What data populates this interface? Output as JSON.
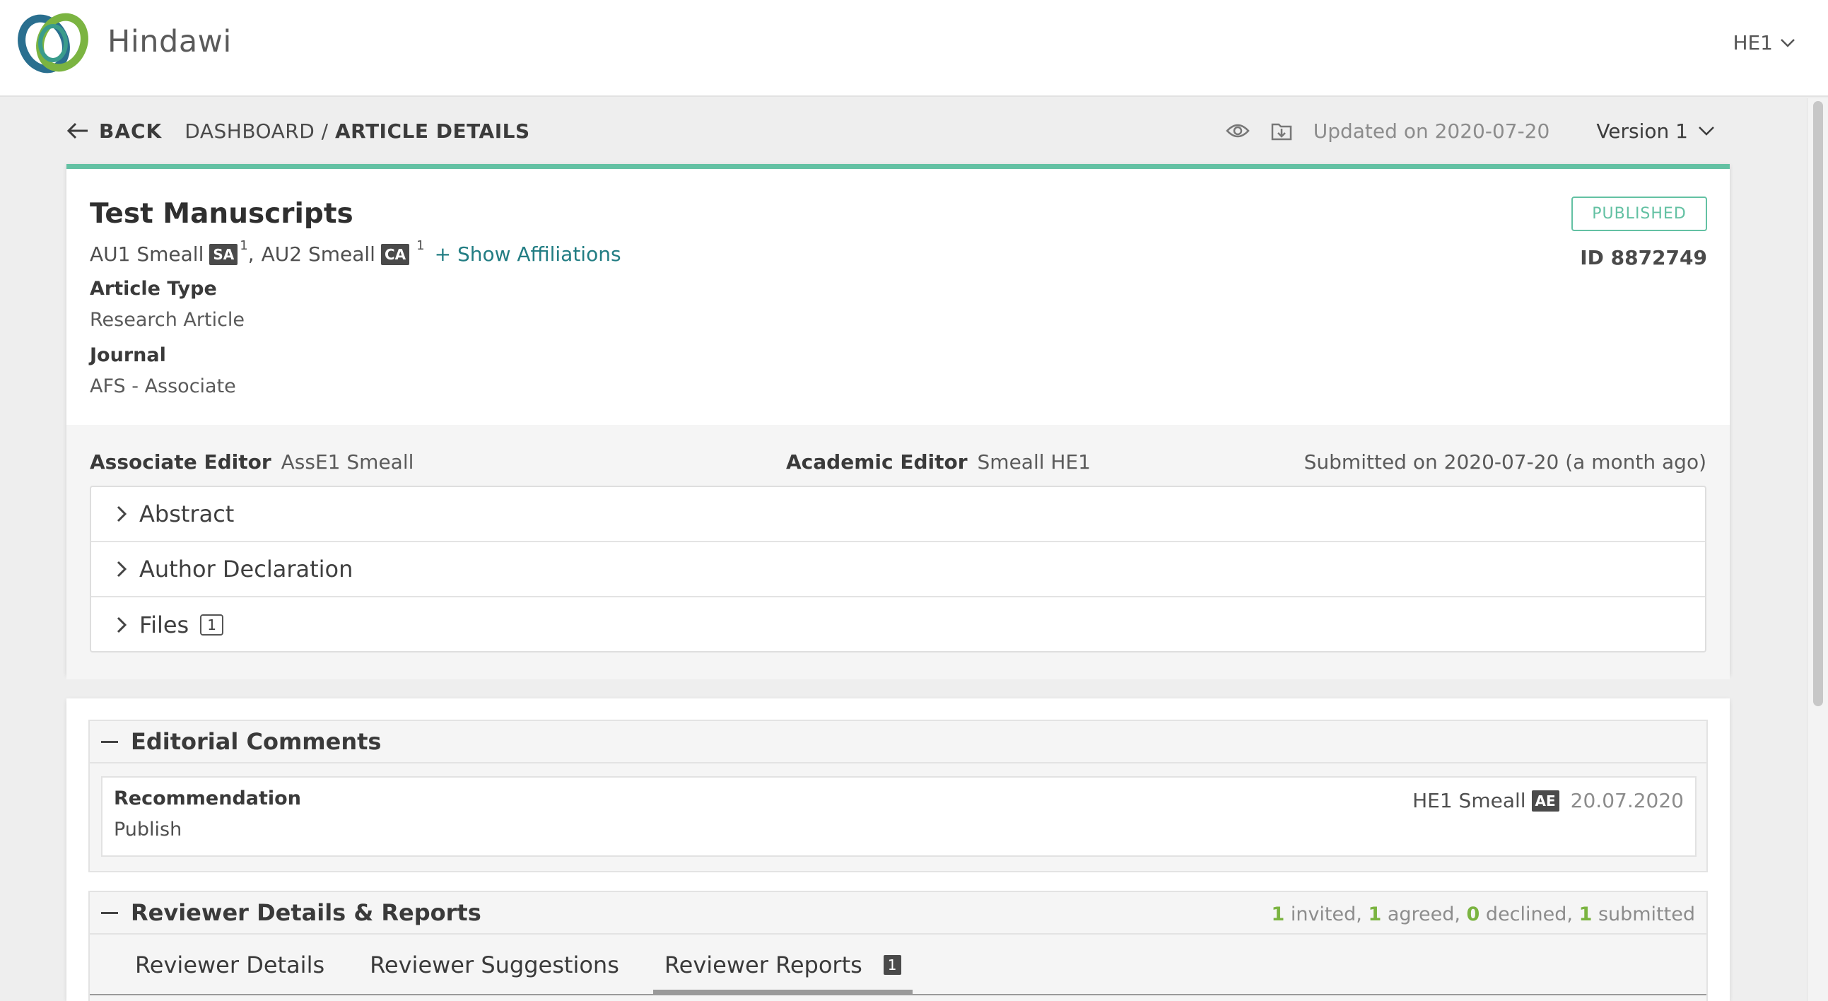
{
  "header": {
    "brand": "Hindawi",
    "logo_icon": "hindawi-rings-logo",
    "user_menu": "HE1"
  },
  "breadcrumb": {
    "back_label": "BACK",
    "path_prefix": "DASHBOARD / ",
    "current": "ARTICLE DETAILS"
  },
  "meta": {
    "updated": "Updated on 2020-07-20",
    "version": "Version 1"
  },
  "manuscript": {
    "title": "Test Manuscripts",
    "status": "PUBLISHED",
    "id_label": "ID 8872749",
    "authors": [
      {
        "name": "AU1 Smeall",
        "tag": "SA",
        "affil": "1"
      },
      {
        "name": "AU2 Smeall",
        "tag": "CA",
        "affil": "1"
      }
    ],
    "author_separator": ",",
    "show_affiliations": "+ Show Affiliations",
    "article_type_label": "Article Type",
    "article_type": "Research Article",
    "journal_label": "Journal",
    "journal": "AFS - Associate"
  },
  "editors": {
    "associate_label": "Associate Editor",
    "associate_name": "AssE1 Smeall",
    "academic_label": "Academic Editor",
    "academic_name": "Smeall HE1",
    "submitted": "Submitted on 2020-07-20 (a month ago)"
  },
  "accordion": [
    {
      "label": "Abstract",
      "count": null
    },
    {
      "label": "Author Declaration",
      "count": null
    },
    {
      "label": "Files",
      "count": "1"
    }
  ],
  "editorial_comments": {
    "title": "Editorial Comments",
    "recommendation_label": "Recommendation",
    "recommendation": "Publish",
    "editor": "HE1 Smeall",
    "editor_tag": "AE",
    "date": "20.07.2020"
  },
  "reviewers": {
    "title": "Reviewer Details & Reports",
    "stats": {
      "invited": "1",
      "invited_label": " invited, ",
      "agreed": "1",
      "agreed_label": " agreed, ",
      "declined": "0",
      "declined_label": " declined, ",
      "submitted": "1",
      "submitted_label": " submitted"
    },
    "tabs": [
      "Reviewer Details",
      "Reviewer Suggestions",
      "Reviewer Reports"
    ],
    "reports_count": "1"
  },
  "colors": {
    "accent_green": "#63c1a3",
    "link_teal": "#227d83",
    "stat_green": "#7bb441"
  }
}
